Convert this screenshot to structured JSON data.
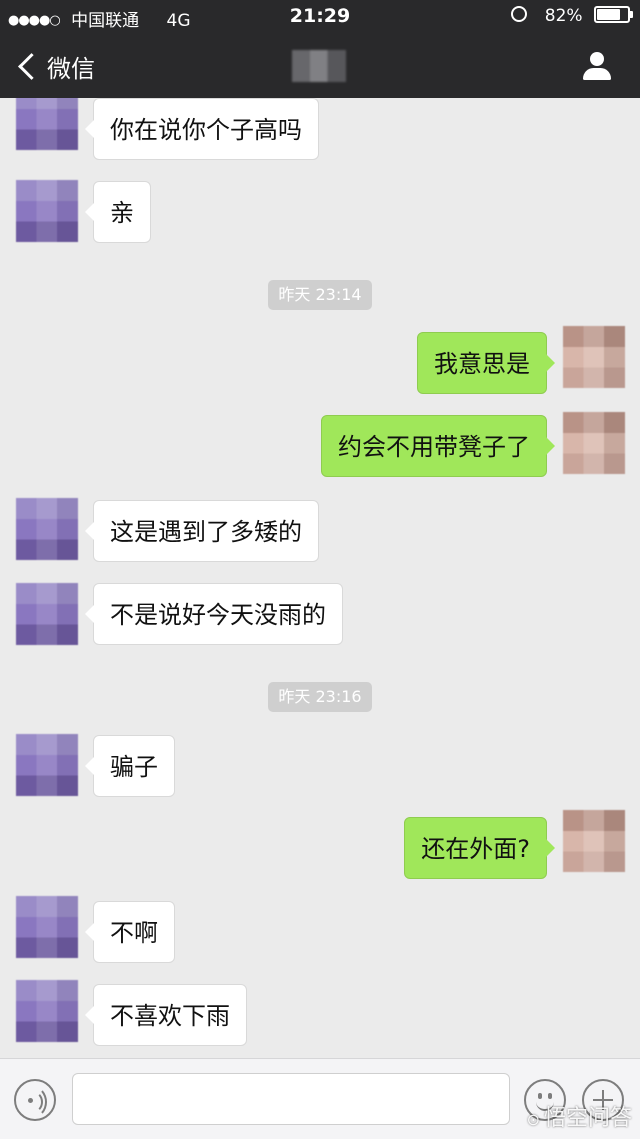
{
  "status_bar": {
    "signal": "●●●●○",
    "carrier": "中国联通",
    "network": "4G",
    "time": "21:29",
    "battery_percent": "82%",
    "battery_level": 0.82
  },
  "nav": {
    "back_label": "微信",
    "back_icon": "chevron-left-icon",
    "profile_icon": "user-icon"
  },
  "messages": [
    {
      "side": "in",
      "text": "你在说你个子高吗"
    },
    {
      "side": "in",
      "text": "亲"
    },
    {
      "timestamp": "昨天 23:14"
    },
    {
      "side": "out",
      "text": "我意思是"
    },
    {
      "side": "out",
      "text": "约会不用带凳子了"
    },
    {
      "side": "in",
      "text": "这是遇到了多矮的"
    },
    {
      "side": "in",
      "text": "不是说好今天没雨的"
    },
    {
      "timestamp": "昨天 23:16"
    },
    {
      "side": "in",
      "text": "骗子"
    },
    {
      "side": "out",
      "text": "还在外面?"
    },
    {
      "side": "in",
      "text": "不啊"
    },
    {
      "side": "in",
      "text": "不喜欢下雨"
    }
  ],
  "input_bar": {
    "voice_icon": "voice-icon",
    "emoji_icon": "emoji-icon",
    "plus_icon": "plus-icon",
    "text_value": ""
  },
  "watermark": {
    "text": "悟空问答"
  },
  "colors": {
    "header_bg": "#29292b",
    "chat_bg": "#ebebeb",
    "outgoing_bubble": "#a0e75a",
    "incoming_bubble": "#ffffff"
  }
}
